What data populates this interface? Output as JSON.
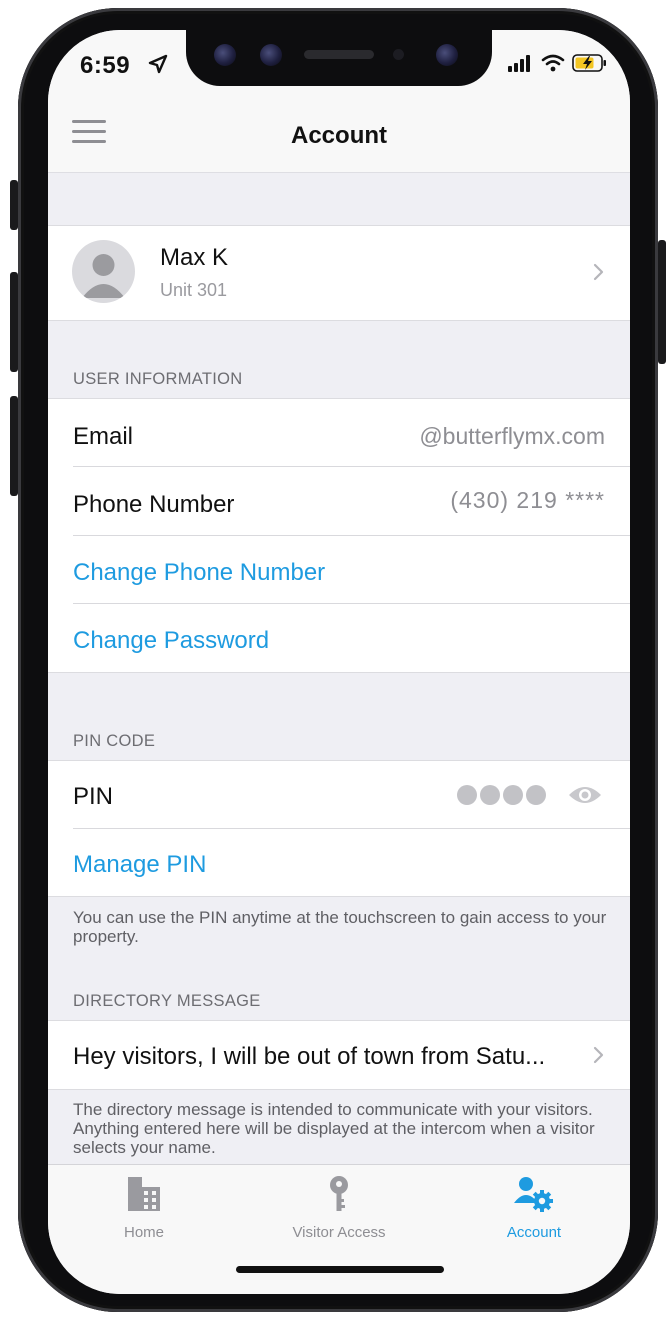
{
  "status_bar": {
    "time": "6:59"
  },
  "nav": {
    "title": "Account"
  },
  "profile": {
    "name": "Max K",
    "unit": "Unit 301"
  },
  "user_info": {
    "header": "USER INFORMATION",
    "email_label": "Email",
    "email_value": "@butterflymx.com",
    "phone_label": "Phone Number",
    "phone_value": "(430) 219 ****",
    "change_phone": "Change Phone Number",
    "change_password": "Change Password"
  },
  "pin": {
    "header": "PIN CODE",
    "label": "PIN",
    "manage": "Manage PIN",
    "footer": "You can use the PIN anytime at the touchscreen to gain access to your property."
  },
  "directory": {
    "header": "DIRECTORY MESSAGE",
    "message": "Hey visitors, I will be out of town from Satu...",
    "footer": "The directory message is intended to communicate with your visitors. Anything entered here will be displayed at the intercom when a visitor selects your name."
  },
  "tabs": [
    {
      "label": "Home",
      "icon": "building-icon"
    },
    {
      "label": "Visitor Access",
      "icon": "key-icon"
    },
    {
      "label": "Account",
      "icon": "user-gear-icon"
    }
  ],
  "colors": {
    "accent": "#1e9be0",
    "secondary_text": "#8e8e93",
    "background": "#efeff4"
  }
}
